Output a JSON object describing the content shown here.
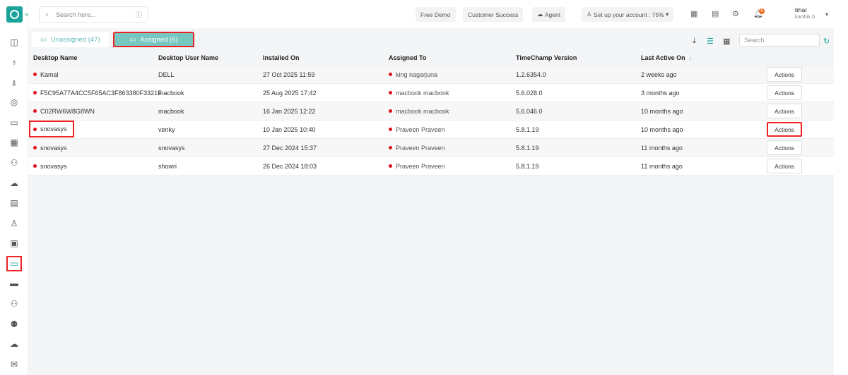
{
  "topbar": {
    "search_placeholder": "Search here...",
    "free_demo": "Free Demo",
    "customer_success": "Customer Success",
    "agent": "Agent",
    "setup": "Set up your account : 75%",
    "notifications": "6",
    "user_name": "bhar",
    "user_sub": "karthik b"
  },
  "tabs": {
    "unassigned": "Unassigned (47)",
    "assigned": "Assigned (6)"
  },
  "table_search_placeholder": "Search",
  "columns": [
    "Desktop Name",
    "Desktop User Name",
    "Installed On",
    "Assigned To",
    "TimeChamp Version",
    "Last Active On"
  ],
  "sort_indicator": "↓",
  "action_label": "Actions",
  "rows": [
    {
      "name": "Kamal",
      "user": "DELL",
      "installed": "27 Oct 2025 11:59",
      "assigned": "king nagarjuna",
      "version": "1.2.6354.0",
      "last": "2 weeks ago"
    },
    {
      "name": "F5C95A77A4CC5F65AC3F863380F3321F",
      "user": "macbook",
      "installed": "25 Aug 2025 17:42",
      "assigned": "macbook macbook",
      "version": "5.6.028.0",
      "last": "3 months ago"
    },
    {
      "name": "C02RW6W8G8WN",
      "user": "macbook",
      "installed": "16 Jan 2025 12:22",
      "assigned": "macbook macbook",
      "version": "5.6.046.0",
      "last": "10 months ago"
    },
    {
      "name": "snovasys",
      "user": "venky",
      "installed": "10 Jan 2025 10:40",
      "assigned": "Praveen Praveen",
      "version": "5.8.1.19",
      "last": "10 months ago"
    },
    {
      "name": "snovasys",
      "user": "snovasys",
      "installed": "27 Dec 2024 15:37",
      "assigned": "Praveen Praveen",
      "version": "5.8.1.19",
      "last": "11 months ago"
    },
    {
      "name": "snovasys",
      "user": "showri",
      "installed": "26 Dec 2024 18:03",
      "assigned": "Praveen Praveen",
      "version": "5.8.1.19",
      "last": "11 months ago"
    }
  ]
}
